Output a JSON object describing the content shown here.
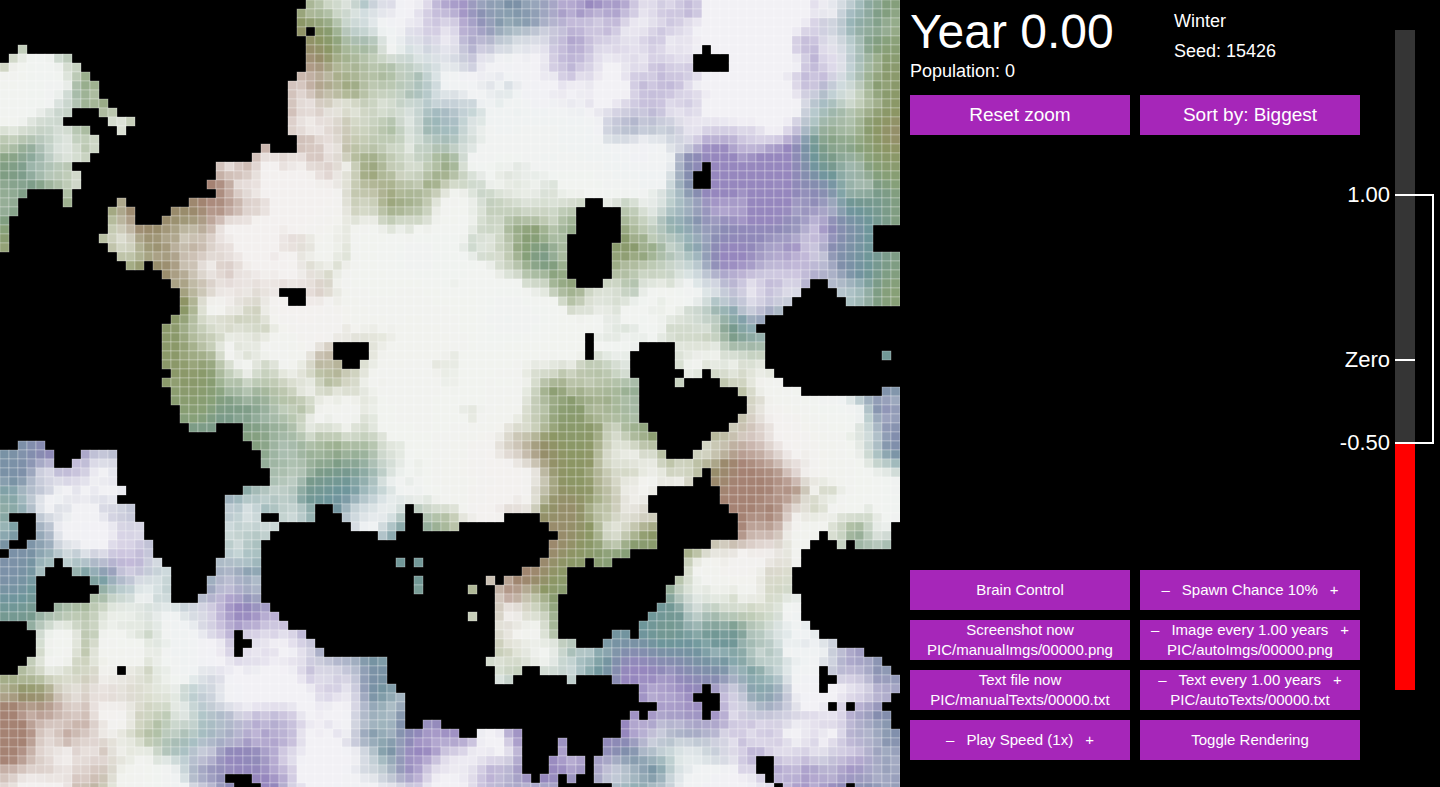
{
  "header": {
    "year": "Year 0.00",
    "population": "Population: 0",
    "season": "Winter",
    "seed": "Seed: 15426"
  },
  "top_buttons": [
    {
      "label": "Reset zoom"
    },
    {
      "label": "Sort by: Biggest"
    }
  ],
  "controls": [
    {
      "kind": "single",
      "label": "Brain Control"
    },
    {
      "kind": "stepper",
      "label": "Spawn Chance 10%",
      "minus": "–",
      "plus": "+"
    },
    {
      "kind": "double",
      "label": "Screenshot now",
      "sublabel": "PIC/manualImgs/00000.png"
    },
    {
      "kind": "stepper-double",
      "label": "Image every 1.00 years",
      "sublabel": "PIC/autoImgs/00000.png",
      "minus": "–",
      "plus": "+"
    },
    {
      "kind": "double",
      "label": "Text file now",
      "sublabel": "PIC/manualTexts/00000.txt"
    },
    {
      "kind": "stepper-double",
      "label": "Text every 1.00 years",
      "sublabel": "PIC/autoTexts/00000.txt",
      "minus": "–",
      "plus": "+"
    },
    {
      "kind": "stepper",
      "label": "Play Speed (1x)",
      "minus": "–",
      "plus": "+"
    },
    {
      "kind": "single",
      "label": "Toggle Rendering"
    }
  ],
  "thermometer": {
    "min": -2,
    "max": 2,
    "value": -0.5,
    "level": 0.375,
    "ticks": [
      {
        "label": "1.00",
        "value": 1
      },
      {
        "label": "Zero",
        "value": 0
      },
      {
        "label": "-0.50",
        "value": -0.5
      }
    ]
  }
}
